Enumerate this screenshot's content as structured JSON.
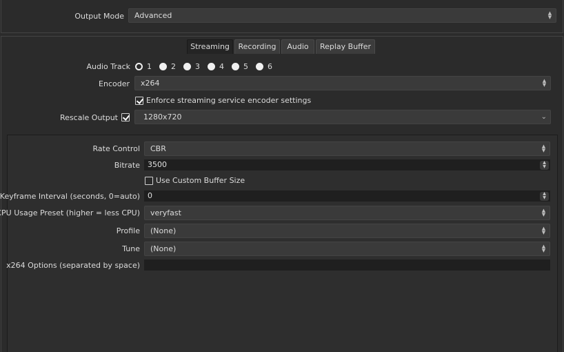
{
  "output_mode": {
    "label": "Output Mode",
    "value": "Advanced"
  },
  "tabs": [
    {
      "label": "Streaming",
      "active": true
    },
    {
      "label": "Recording",
      "active": false
    },
    {
      "label": "Audio",
      "active": false
    },
    {
      "label": "Replay Buffer",
      "active": false
    }
  ],
  "audio_track": {
    "label": "Audio Track",
    "options": [
      "1",
      "2",
      "3",
      "4",
      "5",
      "6"
    ],
    "selected": "1"
  },
  "encoder": {
    "label": "Encoder",
    "value": "x264"
  },
  "enforce": {
    "label": "Enforce streaming service encoder settings",
    "checked": true
  },
  "rescale": {
    "label": "Rescale Output",
    "checked": true,
    "value": "1280x720"
  },
  "rate_control": {
    "label": "Rate Control",
    "value": "CBR"
  },
  "bitrate": {
    "label": "Bitrate",
    "value": "3500"
  },
  "custom_buffer": {
    "label": "Use Custom Buffer Size",
    "checked": false
  },
  "keyframe": {
    "label": "Keyframe Interval (seconds, 0=auto)",
    "value": "0"
  },
  "cpu_preset": {
    "label": "CPU Usage Preset (higher = less CPU)",
    "value": "veryfast"
  },
  "profile": {
    "label": "Profile",
    "value": "(None)"
  },
  "tune": {
    "label": "Tune",
    "value": "(None)"
  },
  "x264_options": {
    "label": "x264 Options (separated by space)",
    "value": ""
  },
  "colors": {
    "background": "#2b2b2b",
    "panel": "#2e2e2e",
    "field": "#1f1f1f",
    "text": "#dcdcdc"
  }
}
